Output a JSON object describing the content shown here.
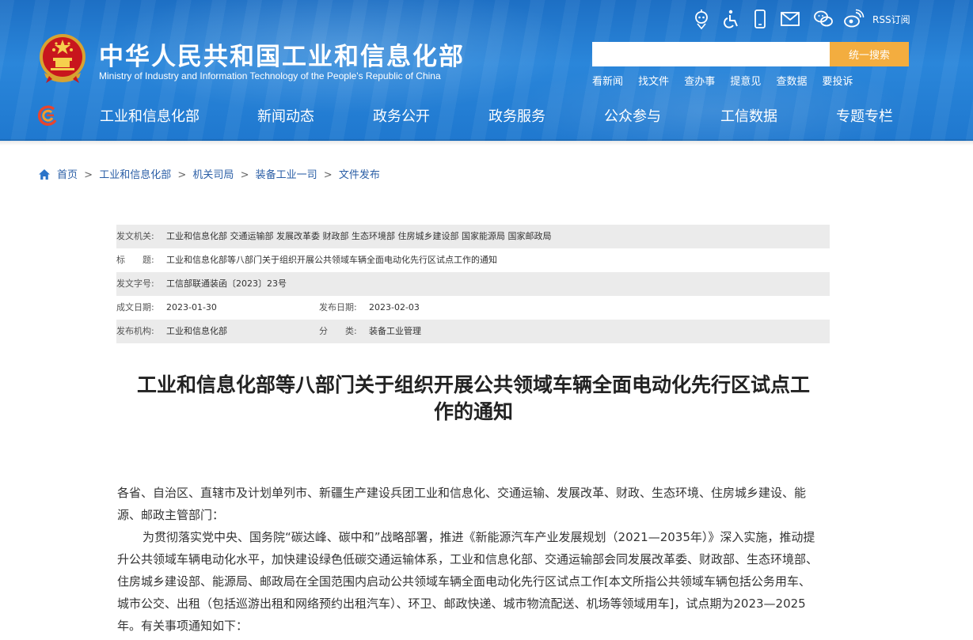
{
  "header": {
    "site_title": "中华人民共和国工业和信息化部",
    "site_subtitle": "Ministry of Industry and Information Technology of the People's Republic of China",
    "rss_label": "RSS订阅",
    "util_icons": [
      "robot-assistant-icon",
      "accessibility-icon",
      "mobile-icon",
      "mail-icon",
      "wechat-icon",
      "weibo-icon"
    ],
    "search": {
      "placeholder": "",
      "button_label": "统一搜索"
    },
    "quick_links": [
      "看新闻",
      "找文件",
      "查办事",
      "提意见",
      "查数据",
      "要投诉"
    ],
    "nav": [
      "工业和信息化部",
      "新闻动态",
      "政务公开",
      "政务服务",
      "公众参与",
      "工信数据",
      "专题专栏"
    ]
  },
  "breadcrumb": {
    "home": "首页",
    "items": [
      "工业和信息化部",
      "机关司局",
      "装备工业一司",
      "文件发布"
    ],
    "separator": ">"
  },
  "meta": {
    "issuer_label": "发文机关:",
    "issuer": "工业和信息化部 交通运输部 发展改革委 财政部 生态环境部 住房城乡建设部 国家能源局 国家邮政局",
    "title_label": "标　　题:",
    "title": "工业和信息化部等八部门关于组织开展公共领域车辆全面电动化先行区试点工作的通知",
    "doc_no_label": "发文字号:",
    "doc_no": "工信部联通装函〔2023〕23号",
    "created_label": "成文日期:",
    "created": "2023-01-30",
    "published_label": "发布日期:",
    "published": "2023-02-03",
    "agency_label": "发布机构:",
    "agency": "工业和信息化部",
    "category_label": "分　　类:",
    "category": "装备工业管理"
  },
  "article": {
    "title_line1": "工业和信息化部等八部门关于组织开展公共领域车辆全面电动化先行区试点工",
    "title_line2": "作的通知",
    "addressee": "各省、自治区、直辖市及计划单列市、新疆生产建设兵团工业和信息化、交通运输、发展改革、财政、生态环境、住房城乡建设、能源、邮政主管部门：",
    "paragraph1": "为贯彻落实党中央、国务院“碳达峰、碳中和”战略部署，推进《新能源汽车产业发展规划（2021—2035年）》深入实施，推动提升公共领域车辆电动化水平，加快建设绿色低碳交通运输体系，工业和信息化部、交通运输部会同发展改革委、财政部、生态环境部、住房城乡建设部、能源局、邮政局在全国范围内启动公共领域车辆全面电动化先行区试点工作[本文所指公共领域车辆包括公务用车、城市公交、出租（包括巡游出租和网络预约出租汽车）、环卫、邮政快递、城市物流配送、机场等领域用车]，试点期为2023—2025年。有关事项通知如下："
  },
  "colors": {
    "header_blue": "#1f78cf",
    "search_button": "#f3ad3f",
    "link_blue": "#2a5ea6"
  }
}
